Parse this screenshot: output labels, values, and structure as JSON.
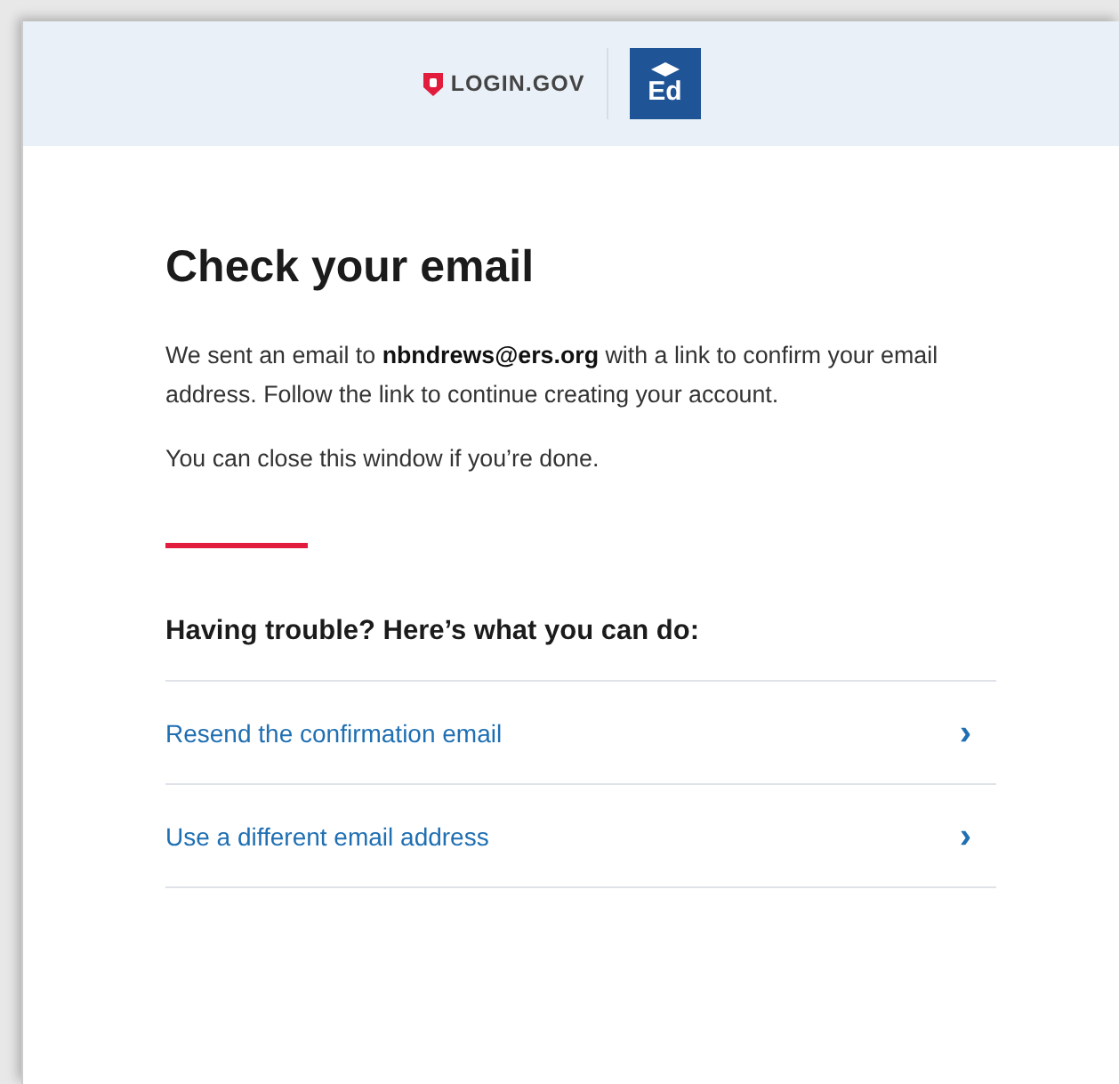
{
  "header": {
    "brand": "LOGIN.GOV",
    "partner_logo": "Ed"
  },
  "heading": "Check your email",
  "paragraphs": [
    "We sent an email to **nbndrews@ers.org** with a link to confirm your email address. Follow the link to continue creating your account.",
    "You can close this window if you’re done."
  ],
  "trouble": {
    "heading": "Having trouble? Here’s what you can do:",
    "links": [
      {
        "label": "Resend the confirmation email",
        "arrow": "›"
      },
      {
        "label": "Use a different email address",
        "arrow": "›"
      }
    ]
  }
}
